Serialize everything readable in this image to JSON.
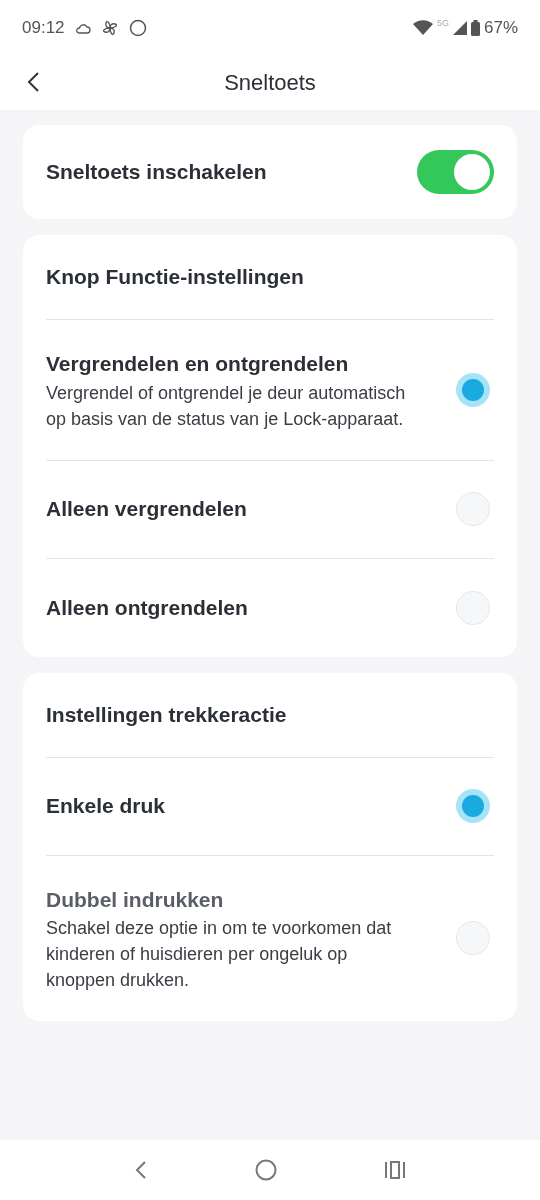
{
  "status_bar": {
    "time": "09:12",
    "network": "5G",
    "battery": "67%"
  },
  "header": {
    "title": "Sneltoets"
  },
  "toggle_card": {
    "label": "Sneltoets inschakelen",
    "on": true
  },
  "sections": [
    {
      "title": "Knop Functie-instellingen",
      "options": [
        {
          "label": "Vergrendelen en ontgrendelen",
          "description": "Vergrendel of ontgrendel je deur automatisch op basis van de status van je Lock-apparaat.",
          "selected": true,
          "disabled": false
        },
        {
          "label": "Alleen vergrendelen",
          "selected": false,
          "disabled": false
        },
        {
          "label": "Alleen ontgrendelen",
          "selected": false,
          "disabled": false
        }
      ]
    },
    {
      "title": "Instellingen trekkeractie",
      "options": [
        {
          "label": "Enkele druk",
          "selected": true,
          "disabled": false
        },
        {
          "label": "Dubbel indrukken",
          "description": "Schakel deze optie in om te voorkomen dat kinderen of huisdieren per ongeluk op knoppen drukken.",
          "selected": false,
          "disabled": true
        }
      ]
    }
  ]
}
